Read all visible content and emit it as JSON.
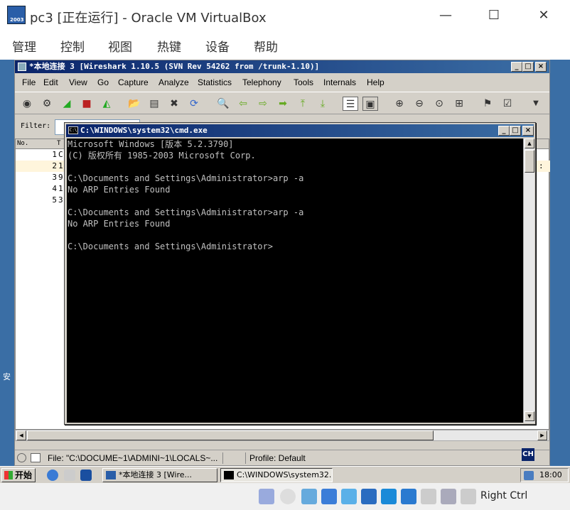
{
  "vbox": {
    "title": "pc3 [正在运行] - Oracle VM VirtualBox",
    "logo_text": "2003",
    "menu": [
      "管理",
      "控制",
      "视图",
      "热键",
      "设备",
      "帮助"
    ],
    "host_key": "Right Ctrl"
  },
  "guest": {
    "desktop_char": "安"
  },
  "wireshark": {
    "title": "*本地连接 3   [Wireshark 1.10.5  (SVN Rev 54262 from /trunk-1.10)]",
    "menu": [
      "File",
      "Edit",
      "View",
      "Go",
      "Capture",
      "Analyze",
      "Statistics",
      "Telephony",
      "Tools",
      "Internals",
      "Help"
    ],
    "filter_label": "Filter:",
    "list_header": {
      "no": "No.",
      "time": "T"
    },
    "packets": [
      {
        "no": "1",
        "t": "C"
      },
      {
        "no": "2",
        "t": "1"
      },
      {
        "no": "3",
        "t": "9"
      },
      {
        "no": "4",
        "t": "1"
      },
      {
        "no": "5",
        "t": "3"
      }
    ],
    "row2_trailing": ":",
    "status_file": "File: \"C:\\DOCUME~1\\ADMINI~1\\LOCALS~...",
    "status_profile": "Profile: Default"
  },
  "cmd": {
    "title": "C:\\WINDOWS\\system32\\cmd.exe",
    "icon_text": "C:\\",
    "lines": [
      "Microsoft Windows [版本 5.2.3790]",
      "(C) 版权所有 1985-2003 Microsoft Corp.",
      "",
      "C:\\Documents and Settings\\Administrator>arp -a",
      "No ARP Entries Found",
      "",
      "C:\\Documents and Settings\\Administrator>arp -a",
      "No ARP Entries Found",
      "",
      "C:\\Documents and Settings\\Administrator>"
    ]
  },
  "taskbar": {
    "start": "开始",
    "tasks": [
      "*本地连接 3   [Wire...",
      "C:\\WINDOWS\\system32..."
    ],
    "lang": "CH",
    "clock": "18:00"
  },
  "colors": {
    "title_gradient_start": "#0a246a",
    "title_gradient_end": "#3b6ea5",
    "desktop": "#3a6ea5",
    "xp_face": "#d4d0c8",
    "console_text": "#c0c0c0",
    "highlight_row": "#fff5dc"
  }
}
